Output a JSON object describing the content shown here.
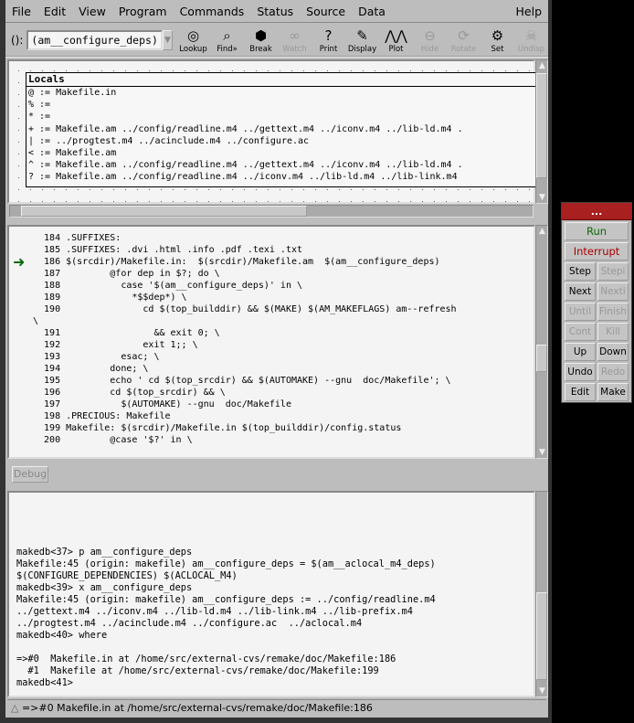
{
  "menu": [
    "File",
    "Edit",
    "View",
    "Program",
    "Commands",
    "Status",
    "Source",
    "Data"
  ],
  "menu_help": "Help",
  "toolbar": {
    "arg_label": "():",
    "arg_value": "(am__configure_deps)",
    "buttons": [
      {
        "label": "Lookup",
        "icon": "lookup-icon",
        "glyph": "◎",
        "enabled": true
      },
      {
        "label": "Find»",
        "icon": "binoculars-icon",
        "glyph": "⌕",
        "enabled": true
      },
      {
        "label": "Break",
        "icon": "stop-sign-icon",
        "glyph": "⬢",
        "enabled": true
      },
      {
        "label": "Watch",
        "icon": "watch-glasses-icon",
        "glyph": "∞",
        "enabled": false
      },
      {
        "label": "Print",
        "icon": "question-mark-icon",
        "glyph": "?",
        "enabled": true
      },
      {
        "label": "Display",
        "icon": "flashlight-icon",
        "glyph": "✎",
        "enabled": true
      },
      {
        "label": "Plot",
        "icon": "plot-icon",
        "glyph": "⋀⋀",
        "enabled": true
      },
      {
        "label": "Hide",
        "icon": "magnifier-icon",
        "glyph": "⊖",
        "enabled": false
      },
      {
        "label": "Rotate",
        "icon": "rotate-icon",
        "glyph": "⟳",
        "enabled": false
      },
      {
        "label": "Set",
        "icon": "gears-icon",
        "glyph": "⚙",
        "enabled": true
      },
      {
        "label": "Undisp",
        "icon": "skull-icon",
        "glyph": "☠",
        "enabled": false
      }
    ]
  },
  "locals": {
    "title": "Locals",
    "lines": [
      "@ := Makefile.in",
      "% :=",
      "* :=",
      "+ := Makefile.am ../config/readline.m4 ../gettext.m4 ../iconv.m4 ../lib-ld.m4 .",
      "| := ../progtest.m4 ../acinclude.m4 ../configure.ac",
      "< := Makefile.am",
      "^ := Makefile.am ../config/readline.m4 ../gettext.m4 ../iconv.m4 ../lib-ld.m4 .",
      "? := Makefile.am ../config/readline.m4 ../iconv.m4 ../lib-ld.m4 ../lib-link.m4"
    ]
  },
  "source": {
    "current_line": 186,
    "lines": [
      "  184 .SUFFIXES:",
      "  185 .SUFFIXES: .dvi .html .info .pdf .texi .txt",
      "  186 $(srcdir)/Makefile.in:  $(srcdir)/Makefile.am  $(am__configure_deps)",
      "  187         @for dep in $?; do \\",
      "  188           case '$(am__configure_deps)' in \\",
      "  189             *$$dep*) \\",
      "  190               cd $(top_builddir) && $(MAKE) $(AM_MAKEFLAGS) am--refresh",
      "\\",
      "  191                 && exit 0; \\",
      "  192               exit 1;; \\",
      "  193           esac; \\",
      "  194         done; \\",
      "  195         echo ' cd $(top_srcdir) && $(AUTOMAKE) --gnu  doc/Makefile'; \\",
      "  196         cd $(top_srcdir) && \\",
      "  197           $(AUTOMAKE) --gnu  doc/Makefile",
      "  198 .PRECIOUS: Makefile",
      "  199 Makefile: $(srcdir)/Makefile.in $(top_builddir)/config.status",
      "  200         @case '$?' in \\"
    ]
  },
  "debug_button": "Debug",
  "console": {
    "lines": [
      "makedb<37> p am__configure_deps",
      "Makefile:45 (origin: makefile) am__configure_deps = $(am__aclocal_m4_deps)",
      "$(CONFIGURE_DEPENDENCIES) $(ACLOCAL_M4)",
      "makedb<39> x am__configure_deps",
      "Makefile:45 (origin: makefile) am__configure_deps := ../config/readline.m4",
      "../gettext.m4 ../iconv.m4 ../lib-ld.m4 ../lib-link.m4 ../lib-prefix.m4",
      "../progtest.m4 ../acinclude.m4 ../configure.ac  ../aclocal.m4",
      "makedb<40> where",
      "",
      "=>#0  Makefile.in at /home/src/external-cvs/remake/doc/Makefile:186",
      "  #1  Makefile at /home/src/external-cvs/remake/doc/Makefile:199",
      "makedb<41>"
    ]
  },
  "status": "=>#0  Makefile.in at /home/src/external-cvs/remake/doc/Makefile:186",
  "panel": {
    "title": "...",
    "run": "Run",
    "interrupt": "Interrupt",
    "buttons": [
      {
        "label": "Step",
        "enabled": true
      },
      {
        "label": "Stepi",
        "enabled": false
      },
      {
        "label": "Next",
        "enabled": true
      },
      {
        "label": "Nexti",
        "enabled": false
      },
      {
        "label": "Until",
        "enabled": false
      },
      {
        "label": "Finish",
        "enabled": false
      },
      {
        "label": "Cont",
        "enabled": false
      },
      {
        "label": "Kill",
        "enabled": false
      },
      {
        "label": "Up",
        "enabled": true
      },
      {
        "label": "Down",
        "enabled": true
      },
      {
        "label": "Undo",
        "enabled": true
      },
      {
        "label": "Redo",
        "enabled": false
      },
      {
        "label": "Edit",
        "enabled": true
      },
      {
        "label": "Make",
        "enabled": true
      }
    ]
  },
  "colors": {
    "accent_red": "#a82020",
    "run_green": "#0a6a0a",
    "interrupt_red": "#aa0000"
  }
}
